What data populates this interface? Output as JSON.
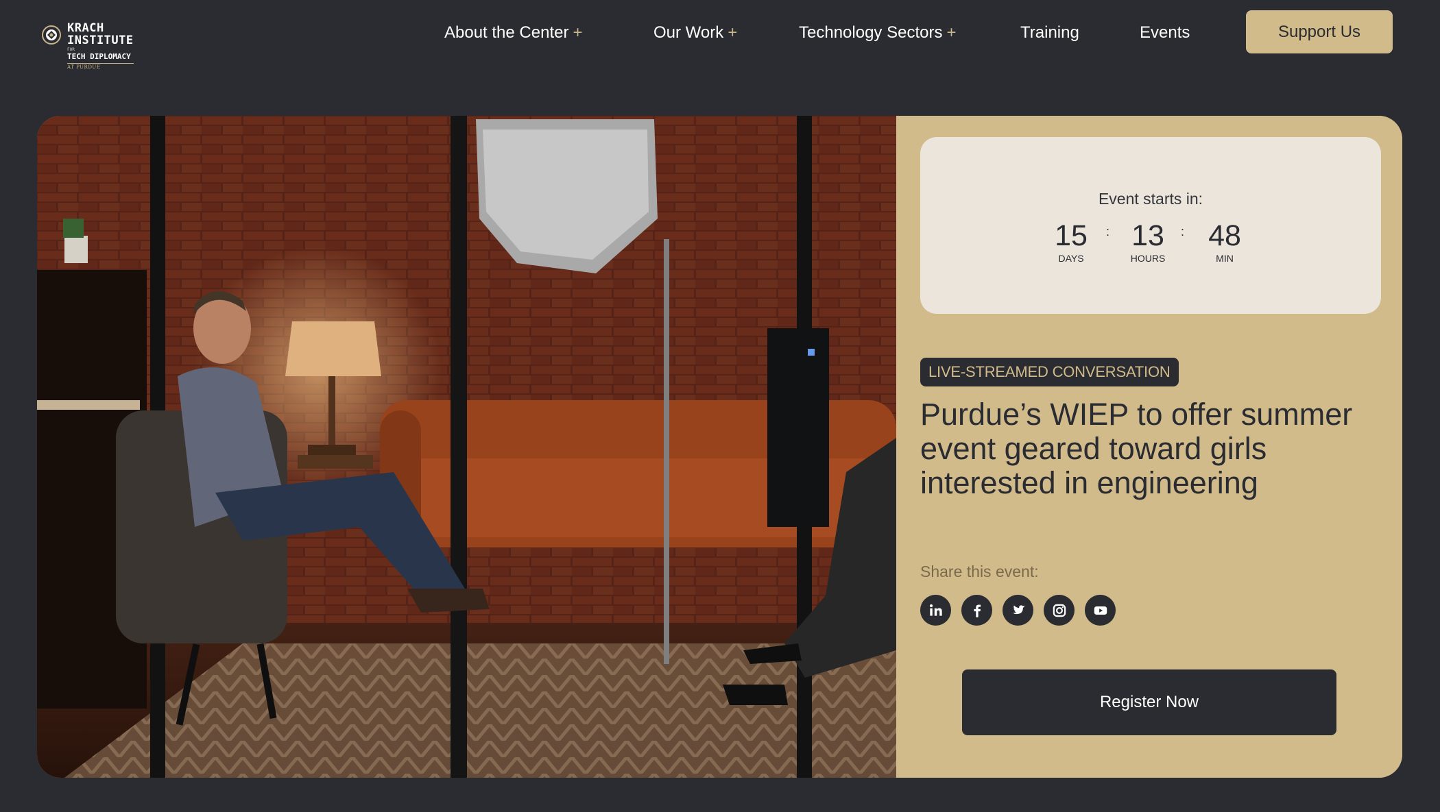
{
  "brand": {
    "line1": "KRACH",
    "line2": "INSTITUTE",
    "line_for": "FOR",
    "line3": "TECH DIPLOMACY",
    "line4": "AT PURDUE",
    "accent": "#d2bb8a",
    "background": "#2a2c31"
  },
  "nav": {
    "items": [
      {
        "label": "About the Center",
        "expand": "+"
      },
      {
        "label": "Our Work",
        "expand": "+"
      },
      {
        "label": "Technology Sectors",
        "expand": "+"
      },
      {
        "label": "Training"
      },
      {
        "label": "Events"
      }
    ],
    "cta": "Support Us"
  },
  "hero": {
    "image_alt": "interview-studio-photo"
  },
  "event": {
    "countdown_label": "Event starts in:",
    "days": "15",
    "days_label": "DAYS",
    "hours": "13",
    "hours_label": "HOURS",
    "minutes": "48",
    "minutes_label": "MIN",
    "separator": ":",
    "badge": "LIVE-STREAMED CONVERSATION",
    "title": "Purdue’s WIEP to offer summer event geared toward girls interested in engineering",
    "share_label": "Share this event:",
    "social": [
      "linkedin-icon",
      "facebook-icon",
      "twitter-icon",
      "instagram-icon",
      "youtube-icon"
    ],
    "register": "Register Now"
  }
}
